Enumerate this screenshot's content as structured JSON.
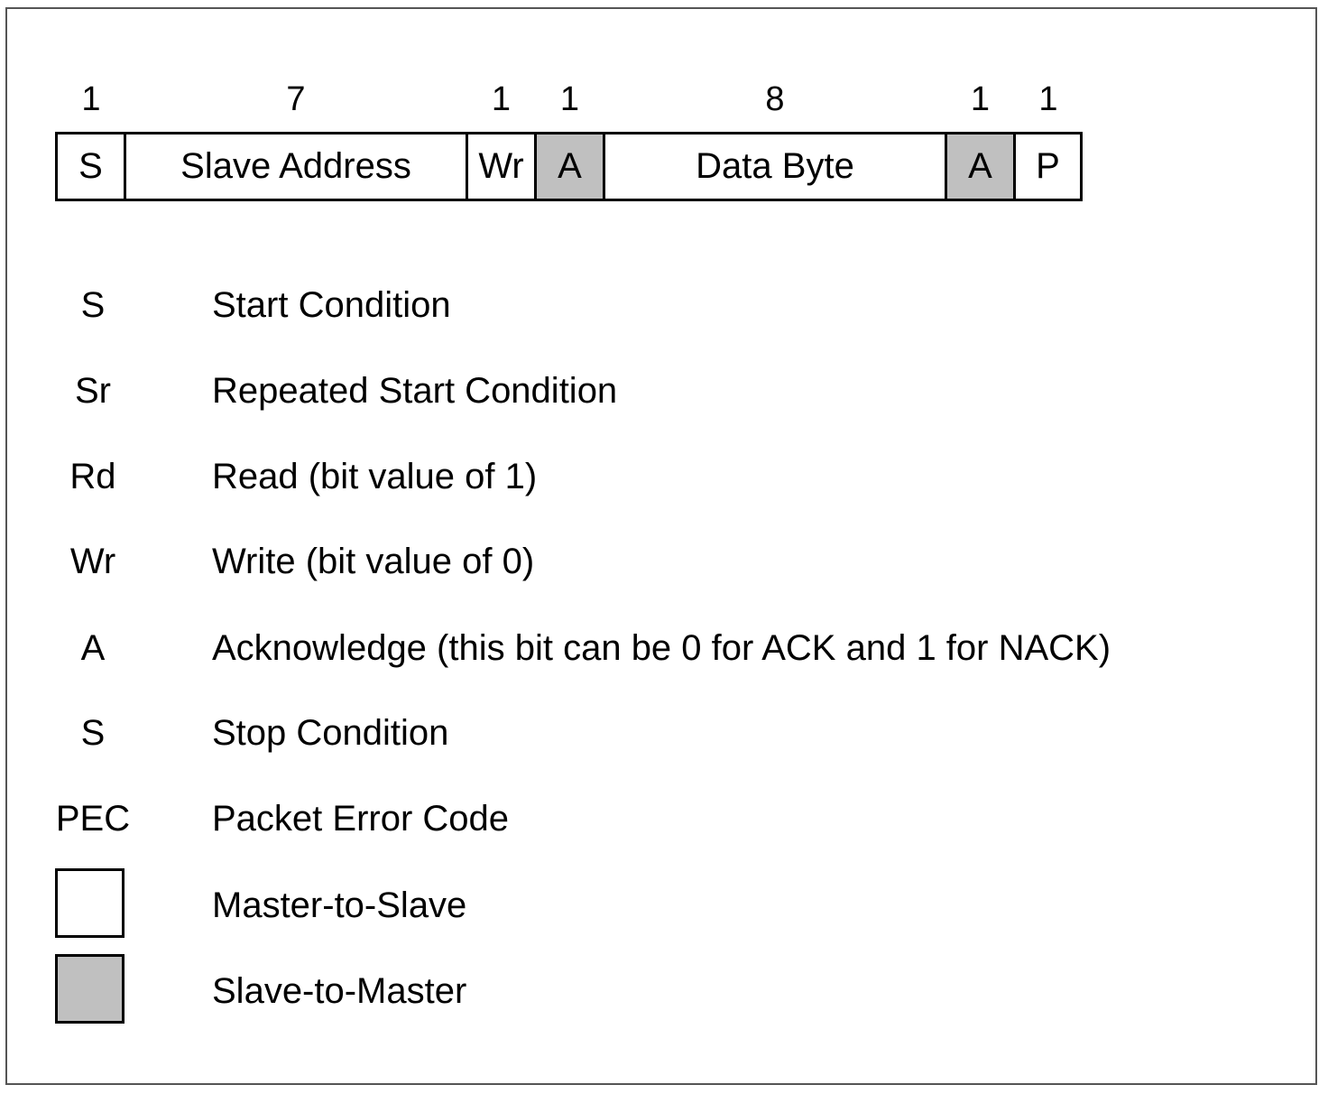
{
  "packet": {
    "fields": [
      {
        "bits": "1",
        "label": "S",
        "direction": "master-to-slave"
      },
      {
        "bits": "7",
        "label": "Slave Address",
        "direction": "master-to-slave"
      },
      {
        "bits": "1",
        "label": "Wr",
        "direction": "master-to-slave"
      },
      {
        "bits": "1",
        "label": "A",
        "direction": "slave-to-master"
      },
      {
        "bits": "8",
        "label": "Data Byte",
        "direction": "master-to-slave"
      },
      {
        "bits": "1",
        "label": "A",
        "direction": "slave-to-master"
      },
      {
        "bits": "1",
        "label": "P",
        "direction": "master-to-slave"
      }
    ]
  },
  "legend": {
    "items": [
      {
        "abbr": "S",
        "desc": "Start Condition"
      },
      {
        "abbr": "Sr",
        "desc": "Repeated Start Condition"
      },
      {
        "abbr": "Rd",
        "desc": "Read (bit value of 1)"
      },
      {
        "abbr": "Wr",
        "desc": "Write (bit value of 0)"
      },
      {
        "abbr": "A",
        "desc": "Acknowledge (this bit can be 0 for ACK and 1 for NACK)"
      },
      {
        "abbr": "S",
        "desc": "Stop Condition"
      },
      {
        "abbr": "PEC",
        "desc": "Packet Error Code"
      }
    ],
    "swatches": [
      {
        "desc": "Master-to-Slave",
        "color": "#ffffff"
      },
      {
        "desc": "Slave-to-Master",
        "color": "#c0c0c0"
      }
    ]
  }
}
